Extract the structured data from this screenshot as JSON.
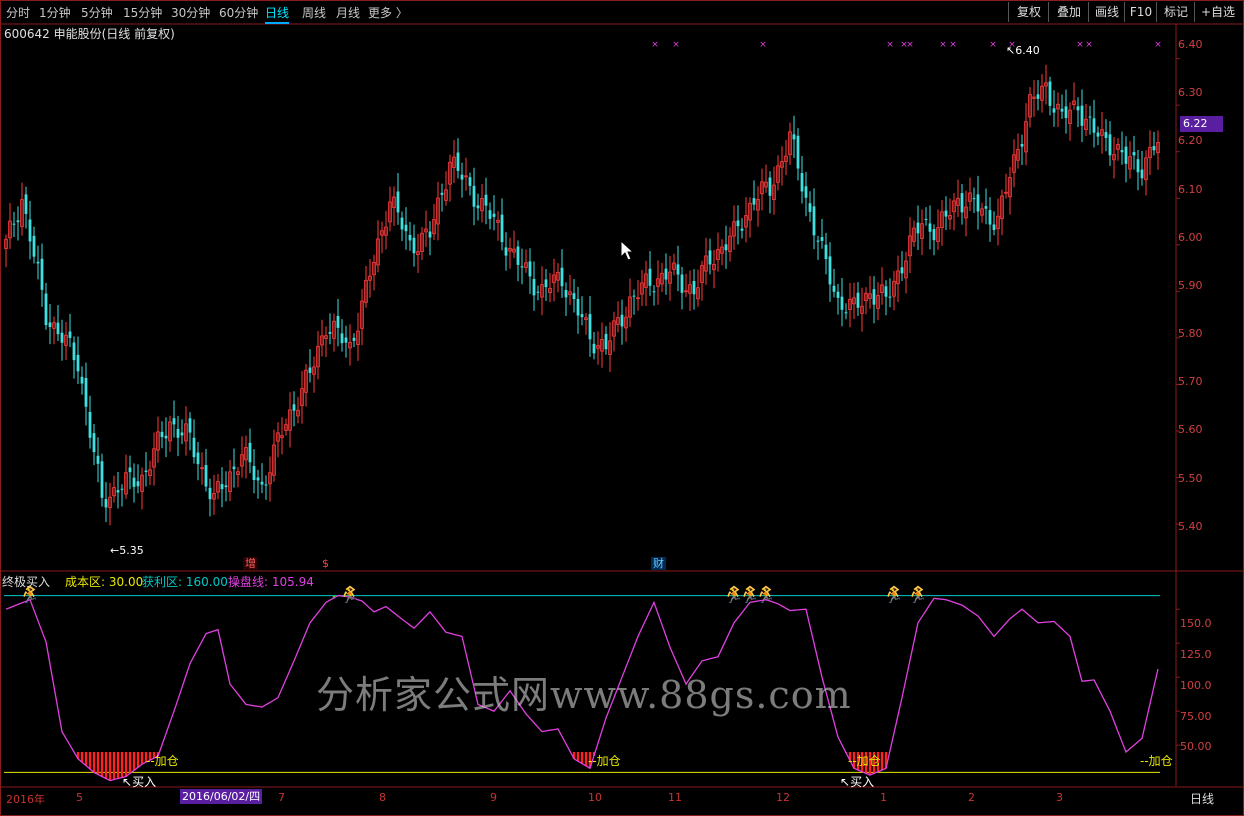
{
  "toolbar": {
    "tabs": [
      "分时",
      "1分钟",
      "5分钟",
      "15分钟",
      "30分钟",
      "60分钟",
      "日线",
      "周线",
      "月线",
      "更多 〉"
    ],
    "active_tab": "日线",
    "right_buttons": [
      "复权",
      "叠加",
      "画线",
      "F10",
      "标记",
      "+自选"
    ]
  },
  "stock": {
    "title": "600642 申能股份(日线 前复权)"
  },
  "price_axis": {
    "ticks": [
      "6.40",
      "6.30",
      "6.20",
      "6.10",
      "6.00",
      "5.90",
      "5.80",
      "5.70",
      "5.60",
      "5.50",
      "5.40"
    ],
    "current_price": "6.22"
  },
  "indicator": {
    "name": "终极买入",
    "params": [
      {
        "label": "成本区: 30.00",
        "color": "#e8e800"
      },
      {
        "label": "获利区: 160.00",
        "color": "#00c8c8"
      },
      {
        "label": "操盘线: 105.94",
        "color": "#e040e0"
      }
    ],
    "axis_ticks": [
      "150.0",
      "125.0",
      "100.0",
      "75.00",
      "50.00"
    ],
    "annotations": {
      "add": "--加仓",
      "buy": "买入"
    }
  },
  "event_markers": [
    "增",
    "$",
    "财"
  ],
  "time_axis": {
    "labels": [
      "2016年",
      "5",
      "7",
      "8",
      "9",
      "10",
      "11",
      "12",
      "1",
      "2",
      "3"
    ],
    "cursor_date": "2016/06/02/四",
    "period": "日线"
  },
  "price_annotations": {
    "low": "5.35",
    "high": "6.40"
  },
  "watermark": "分析家公式网www.88gs.com",
  "chart_data": [
    {
      "type": "candlestick",
      "title": "600642 申能股份(日线 前复权)",
      "ylim": [
        5.34,
        6.44
      ],
      "highest": 6.4,
      "lowest": 5.35,
      "last": 6.22,
      "anchors": [
        {
          "idx": 0,
          "close": 6.0
        },
        {
          "idx": 4,
          "close": 6.1
        },
        {
          "idx": 10,
          "close": 5.85
        },
        {
          "idx": 18,
          "close": 5.75
        },
        {
          "idx": 24,
          "close": 5.45
        },
        {
          "idx": 28,
          "close": 5.48
        },
        {
          "idx": 34,
          "close": 5.5
        },
        {
          "idx": 41,
          "close": 5.62
        },
        {
          "idx": 46,
          "close": 5.58
        },
        {
          "idx": 52,
          "close": 5.45
        },
        {
          "idx": 59,
          "close": 5.55
        },
        {
          "idx": 64,
          "close": 5.48
        },
        {
          "idx": 70,
          "close": 5.62
        },
        {
          "idx": 76,
          "close": 5.72
        },
        {
          "idx": 80,
          "close": 5.83
        },
        {
          "idx": 86,
          "close": 5.78
        },
        {
          "idx": 90,
          "close": 5.9
        },
        {
          "idx": 96,
          "close": 6.1
        },
        {
          "idx": 101,
          "close": 6.0
        },
        {
          "idx": 106,
          "close": 6.02
        },
        {
          "idx": 111,
          "close": 6.18
        },
        {
          "idx": 116,
          "close": 6.12
        },
        {
          "idx": 122,
          "close": 6.05
        },
        {
          "idx": 128,
          "close": 5.96
        },
        {
          "idx": 134,
          "close": 5.9
        },
        {
          "idx": 139,
          "close": 5.93
        },
        {
          "idx": 146,
          "close": 5.8
        },
        {
          "idx": 150,
          "close": 5.78
        },
        {
          "idx": 156,
          "close": 5.88
        },
        {
          "idx": 161,
          "close": 5.92
        },
        {
          "idx": 166,
          "close": 5.94
        },
        {
          "idx": 172,
          "close": 5.9
        },
        {
          "idx": 176,
          "close": 5.97
        },
        {
          "idx": 182,
          "close": 6.02
        },
        {
          "idx": 187,
          "close": 6.1
        },
        {
          "idx": 191,
          "close": 6.12
        },
        {
          "idx": 196,
          "close": 6.23
        },
        {
          "idx": 200,
          "close": 6.1
        },
        {
          "idx": 204,
          "close": 5.98
        },
        {
          "idx": 208,
          "close": 5.88
        },
        {
          "idx": 212,
          "close": 5.86
        },
        {
          "idx": 216,
          "close": 5.9
        },
        {
          "idx": 220,
          "close": 5.88
        },
        {
          "idx": 225,
          "close": 5.98
        },
        {
          "idx": 229,
          "close": 6.05
        },
        {
          "idx": 233,
          "close": 6.03
        },
        {
          "idx": 238,
          "close": 6.1
        },
        {
          "idx": 243,
          "close": 6.08
        },
        {
          "idx": 248,
          "close": 6.05
        },
        {
          "idx": 252,
          "close": 6.18
        },
        {
          "idx": 256,
          "close": 6.3
        },
        {
          "idx": 260,
          "close": 6.34
        },
        {
          "idx": 264,
          "close": 6.27
        },
        {
          "idx": 268,
          "close": 6.3
        },
        {
          "idx": 272,
          "close": 6.24
        },
        {
          "idx": 276,
          "close": 6.22
        },
        {
          "idx": 280,
          "close": 6.18
        },
        {
          "idx": 284,
          "close": 6.17
        },
        {
          "idx": 288,
          "close": 6.22
        }
      ],
      "count": 289
    },
    {
      "type": "line",
      "title": "终极买入",
      "ylim": [
        20,
        170
      ],
      "levels": {
        "成本区": 30.0,
        "获利区": 160.0
      },
      "last": 105.94,
      "series": [
        {
          "name": "操盘线",
          "points": [
            [
              0,
              150
            ],
            [
              6,
              157
            ],
            [
              10,
              126
            ],
            [
              14,
              60
            ],
            [
              18,
              40
            ],
            [
              22,
              30
            ],
            [
              26,
              24
            ],
            [
              30,
              27
            ],
            [
              34,
              36
            ],
            [
              38,
              42
            ],
            [
              42,
              75
            ],
            [
              46,
              110
            ],
            [
              50,
              132
            ],
            [
              53,
              135
            ],
            [
              56,
              95
            ],
            [
              60,
              80
            ],
            [
              64,
              78
            ],
            [
              68,
              85
            ],
            [
              72,
              112
            ],
            [
              76,
              140
            ],
            [
              80,
              155
            ],
            [
              83,
              160
            ],
            [
              86,
              159
            ],
            [
              89,
              156
            ],
            [
              92,
              148
            ],
            [
              95,
              152
            ],
            [
              98,
              145
            ],
            [
              102,
              136
            ],
            [
              106,
              148
            ],
            [
              110,
              133
            ],
            [
              114,
              130
            ],
            [
              118,
              80
            ],
            [
              122,
              75
            ],
            [
              126,
              90
            ],
            [
              130,
              73
            ],
            [
              134,
              60
            ],
            [
              138,
              62
            ],
            [
              142,
              40
            ],
            [
              146,
              33
            ],
            [
              150,
              70
            ],
            [
              154,
              100
            ],
            [
              158,
              130
            ],
            [
              162,
              155
            ],
            [
              166,
              122
            ],
            [
              170,
              95
            ],
            [
              174,
              112
            ],
            [
              178,
              115
            ],
            [
              182,
              140
            ],
            [
              186,
              155
            ],
            [
              190,
              157
            ],
            [
              193,
              154
            ],
            [
              196,
              149
            ],
            [
              200,
              150
            ],
            [
              204,
              100
            ],
            [
              208,
              56
            ],
            [
              212,
              33
            ],
            [
              216,
              28
            ],
            [
              220,
              33
            ],
            [
              224,
              85
            ],
            [
              228,
              140
            ],
            [
              232,
              158
            ],
            [
              235,
              157
            ],
            [
              239,
              153
            ],
            [
              243,
              145
            ],
            [
              247,
              130
            ],
            [
              251,
              143
            ],
            [
              254,
              150
            ],
            [
              258,
              140
            ],
            [
              262,
              141
            ],
            [
              266,
              130
            ],
            [
              269,
              97
            ],
            [
              272,
              98
            ],
            [
              276,
              75
            ],
            [
              280,
              45
            ],
            [
              284,
              55
            ],
            [
              288,
              106
            ]
          ]
        }
      ]
    }
  ]
}
